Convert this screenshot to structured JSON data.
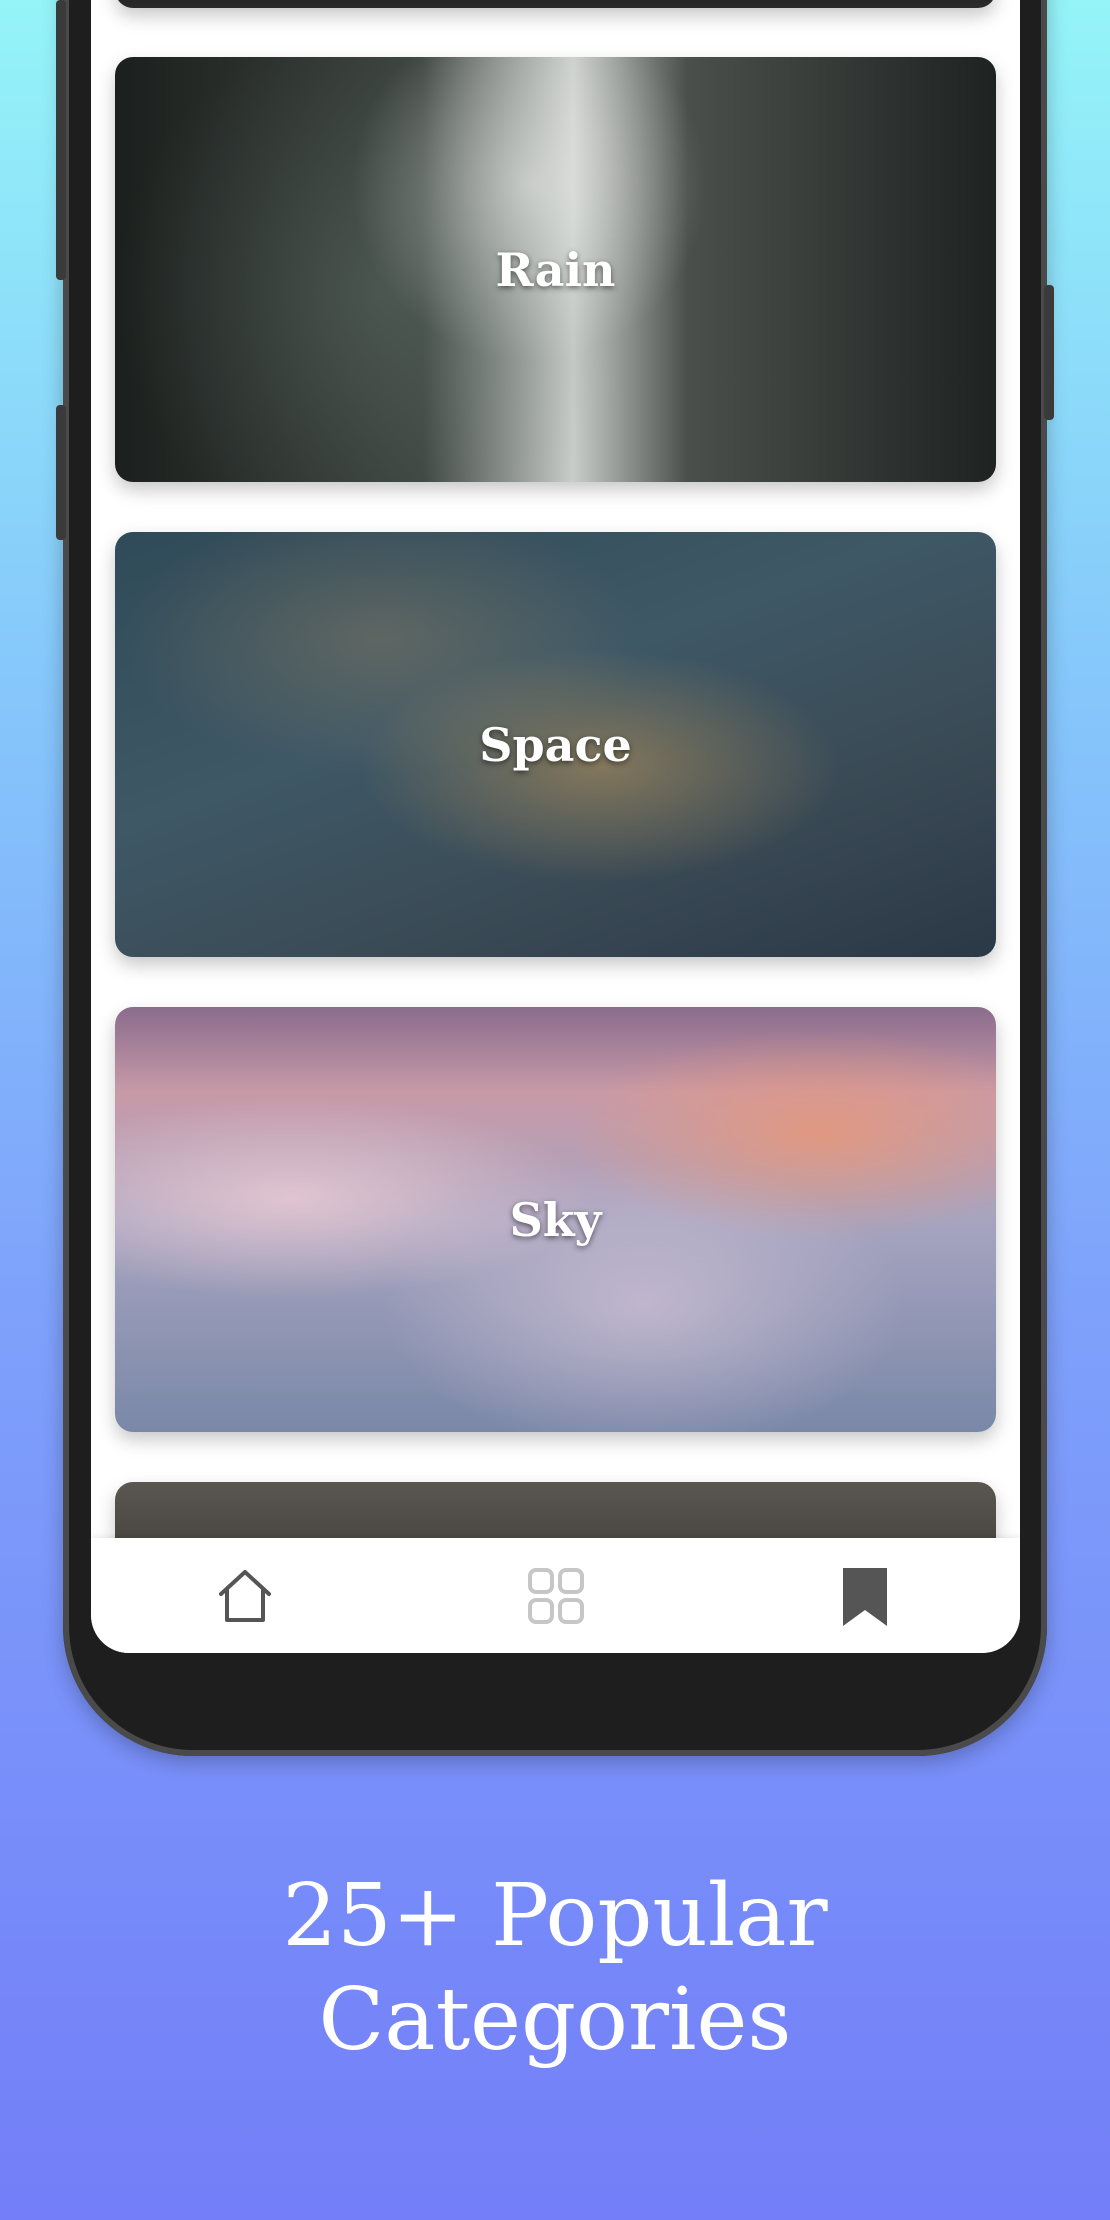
{
  "categories": [
    {
      "label": "Rain"
    },
    {
      "label": "Space"
    },
    {
      "label": "Sky"
    }
  ],
  "nav": {
    "items": [
      {
        "icon": "home-icon"
      },
      {
        "icon": "grid-icon"
      },
      {
        "icon": "bookmark-icon"
      }
    ]
  },
  "tagline": {
    "line1": "25+ Popular",
    "line2": "Categories"
  },
  "colors": {
    "background_top": "#94f4f8",
    "background_bottom": "#737ef8",
    "nav_icon_active": "#555555",
    "nav_icon_inactive": "#c6c6c6"
  }
}
